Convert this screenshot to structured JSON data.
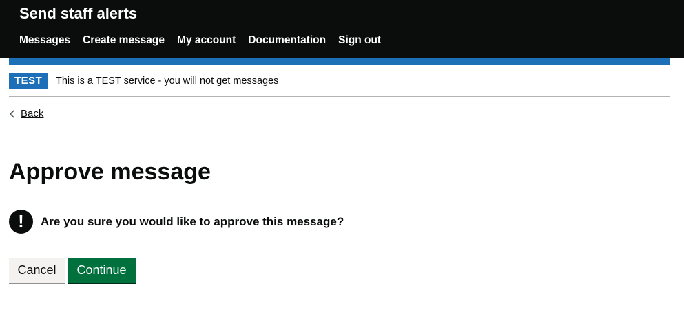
{
  "header": {
    "service_name": "Send staff alerts",
    "nav": [
      {
        "label": "Messages"
      },
      {
        "label": "Create message"
      },
      {
        "label": "My account"
      },
      {
        "label": "Documentation"
      },
      {
        "label": "Sign out"
      }
    ]
  },
  "phase_banner": {
    "tag": "TEST",
    "text": "This is a TEST service - you will not get messages"
  },
  "back_link": {
    "label": "Back",
    "icon": "chevron-left-icon"
  },
  "main": {
    "title": "Approve message",
    "warning": {
      "icon": "exclamation-icon",
      "icon_glyph": "!",
      "text": "Are you sure you would like to approve this message?"
    }
  },
  "buttons": {
    "cancel_label": "Cancel",
    "continue_label": "Continue"
  },
  "colors": {
    "header_bg": "#0b0c0c",
    "blue_bar": "#1d70b8",
    "tag_bg": "#1d70b8",
    "continue_bg": "#00703c",
    "cancel_bg": "#f3f2f1"
  }
}
